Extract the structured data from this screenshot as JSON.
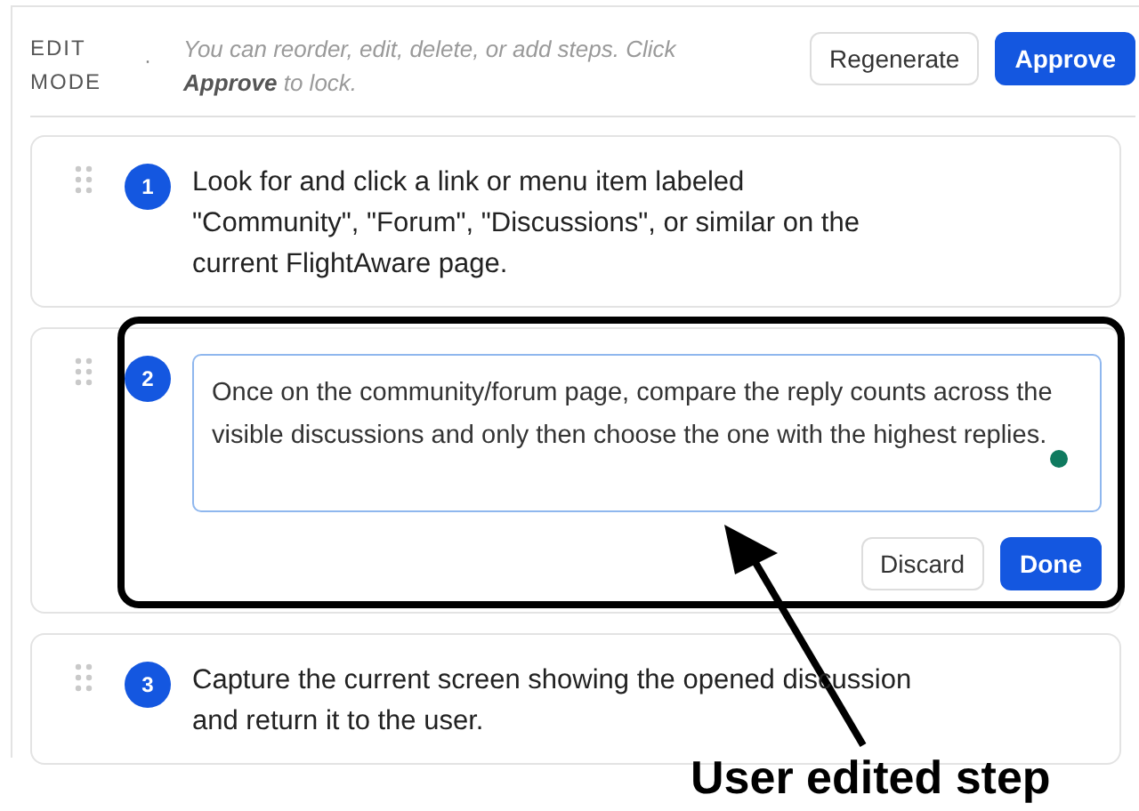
{
  "header": {
    "mode_label": "EDIT MODE",
    "separator": "·",
    "hint": "You can reorder, edit, delete, or add steps. Click **Approve** to lock.",
    "buttons": [
      {
        "label": "Regenerate",
        "kind": "secondary"
      },
      {
        "label": "Approve",
        "kind": "primary"
      }
    ]
  },
  "steps": [
    {
      "number": "1",
      "kind": "view",
      "text": "Look for and click a link or menu item labeled \"Community\", \"Forum\", \"Discussions\", or similar on the current FlightAware page."
    },
    {
      "number": "2",
      "kind": "editing",
      "text": "Once on the community/forum page, compare the reply counts across the visible discussions and only then choose the one with the highest replies.",
      "buttons": [
        {
          "label": "Discard",
          "kind": "secondary"
        },
        {
          "label": "Done",
          "kind": "primary"
        }
      ]
    },
    {
      "number": "3",
      "kind": "view",
      "text": "Capture the current screen showing the opened discussion and return it to the user."
    }
  ],
  "annotation": {
    "label": "User edited step"
  }
}
